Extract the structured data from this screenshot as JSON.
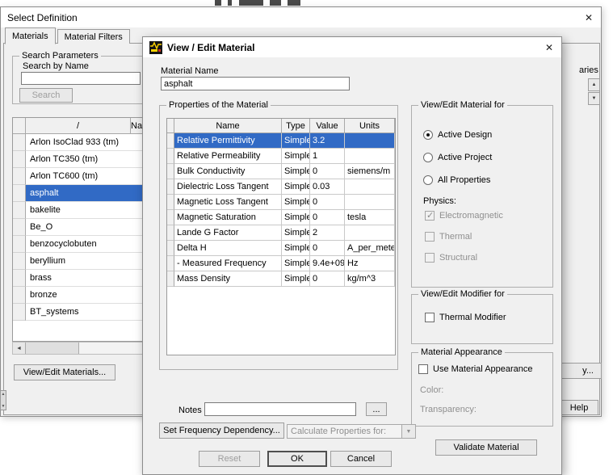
{
  "icons": {
    "close": "✕",
    "dropdown_arrow": "▼",
    "scroll_left_arrow": "◄",
    "scroll_up_arrow": "▲",
    "scroll_down_arrow": "▼",
    "sort_glyph": "/"
  },
  "colors": {
    "selection": "#316ac5",
    "selection_text": "#ffffff",
    "dialog_bg": "#f0f0f0"
  },
  "select_definition": {
    "title": "Select Definition",
    "tabs": [
      {
        "label": "Materials",
        "active": true
      },
      {
        "label": "Material Filters",
        "active": false
      }
    ],
    "search": {
      "legend": "Search Parameters",
      "name_label": "Search by Name",
      "value": "",
      "button": "Search"
    },
    "list": {
      "header_name_clipped": "Na"
    },
    "materials": [
      "Arlon IsoClad 933 (tm)",
      "Arlon TC350 (tm)",
      "Arlon TC600 (tm)",
      "asphalt",
      "bakelite",
      "Be_O",
      "benzocyclobuten",
      "beryllium",
      "brass",
      "bronze",
      "BT_systems"
    ],
    "selected_material": "asphalt",
    "view_edit_materials_button": "View/Edit Materials...",
    "libraries_clipped": "aries",
    "export_button_clipped": "y...",
    "help_button": "Help"
  },
  "view_edit_material": {
    "title": "View / Edit Material",
    "material_name_label": "Material Name",
    "material_name_value": "asphalt",
    "properties": {
      "legend": "Properties of the Material",
      "columns": [
        "Name",
        "Type",
        "Value",
        "Units"
      ],
      "rows": [
        {
          "name": "Relative Permittivity",
          "type": "Simple",
          "value": "3.2",
          "units": "",
          "selected": true
        },
        {
          "name": "Relative Permeability",
          "type": "Simple",
          "value": "1",
          "units": "",
          "selected": false
        },
        {
          "name": "Bulk Conductivity",
          "type": "Simple",
          "value": "0",
          "units": "siemens/m",
          "selected": false
        },
        {
          "name": "Dielectric Loss Tangent",
          "type": "Simple",
          "value": "0.03",
          "units": "",
          "selected": false
        },
        {
          "name": "Magnetic Loss Tangent",
          "type": "Simple",
          "value": "0",
          "units": "",
          "selected": false
        },
        {
          "name": "Magnetic Saturation",
          "type": "Simple",
          "value": "0",
          "units": "tesla",
          "selected": false
        },
        {
          "name": "Lande G Factor",
          "type": "Simple",
          "value": "2",
          "units": "",
          "selected": false
        },
        {
          "name": "Delta H",
          "type": "Simple",
          "value": "0",
          "units": "A_per_meter",
          "selected": false
        },
        {
          "name": "- Measured Frequency",
          "type": "Simple",
          "value": "9.4e+09",
          "units": "Hz",
          "selected": false
        },
        {
          "name": "Mass Density",
          "type": "Simple",
          "value": "0",
          "units": "kg/m^3",
          "selected": false
        }
      ]
    },
    "view_edit_for": {
      "legend": "View/Edit Material for",
      "radios": [
        {
          "label": "Active Design",
          "selected": true
        },
        {
          "label": "Active Project",
          "selected": false
        },
        {
          "label": "All Properties",
          "selected": false
        }
      ],
      "physics_label": "Physics:",
      "physics": [
        {
          "label": "Electromagnetic",
          "checked": true,
          "enabled": false
        },
        {
          "label": "Thermal",
          "checked": false,
          "enabled": false
        },
        {
          "label": "Structural",
          "checked": false,
          "enabled": false
        }
      ]
    },
    "modifier": {
      "legend": "View/Edit Modifier for",
      "checkbox_label": "Thermal Modifier",
      "checked": false
    },
    "appearance": {
      "legend": "Material Appearance",
      "checkbox_label": "Use Material Appearance",
      "checked": false,
      "color_label": "Color:",
      "transparency_label": "Transparency:"
    },
    "validate_button": "Validate Material",
    "notes_label": "Notes",
    "notes_value": "",
    "notes_browse_button": "...",
    "set_frequency_button": "Set Frequency Dependency...",
    "calculate_dropdown": {
      "label": "Calculate Properties for:",
      "enabled": false
    },
    "reset_button": "Reset",
    "ok_button": "OK",
    "cancel_button": "Cancel"
  }
}
